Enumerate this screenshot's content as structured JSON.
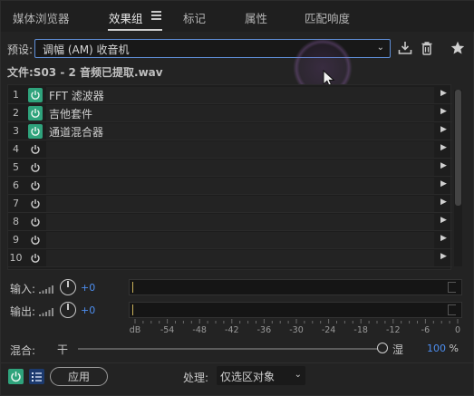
{
  "tabs": [
    {
      "label": "媒体浏览器"
    },
    {
      "label": "效果组"
    },
    {
      "label": "标记"
    },
    {
      "label": "属性"
    },
    {
      "label": "匹配响度"
    }
  ],
  "preset": {
    "label": "预设:",
    "value": "调幅 (AM) 收音机"
  },
  "file": "文件:S03 - 2 音频已提取.wav",
  "rack": {
    "rows": [
      {
        "num": "1",
        "name": "FFT 滤波器",
        "on": true
      },
      {
        "num": "2",
        "name": "吉他套件",
        "on": true
      },
      {
        "num": "3",
        "name": "通道混合器",
        "on": true
      },
      {
        "num": "4",
        "name": "",
        "on": false
      },
      {
        "num": "5",
        "name": "",
        "on": false
      },
      {
        "num": "6",
        "name": "",
        "on": false
      },
      {
        "num": "7",
        "name": "",
        "on": false
      },
      {
        "num": "8",
        "name": "",
        "on": false
      },
      {
        "num": "9",
        "name": "",
        "on": false
      },
      {
        "num": "10",
        "name": "",
        "on": false
      }
    ]
  },
  "input": {
    "label": "输入:",
    "gain": "+0"
  },
  "output": {
    "label": "输出:",
    "gain": "+0"
  },
  "db_scale": [
    "dB",
    "-54",
    "-48",
    "-42",
    "-36",
    "-30",
    "-24",
    "-18",
    "-12",
    "-6",
    "0"
  ],
  "mix": {
    "label": "混合:",
    "dry": "干",
    "wet": "湿",
    "value": "100",
    "unit": "%"
  },
  "footer": {
    "apply": "应用",
    "process_label": "处理:",
    "process_value": "仅选区对象"
  },
  "colors": {
    "power_on": "#2fa37c",
    "accent_blue": "#4d8ef0",
    "focus_border": "#5f8fd8"
  },
  "icons": {
    "tab_menu": "hamburger-menu-icon",
    "save_preset": "download-icon",
    "delete_preset": "trash-icon",
    "favorite": "star-icon",
    "power": "power-icon",
    "row_menu": "triangle-right-icon",
    "input_level": "level-bars-icon",
    "knob": "gain-knob-icon",
    "list": "list-icon"
  }
}
